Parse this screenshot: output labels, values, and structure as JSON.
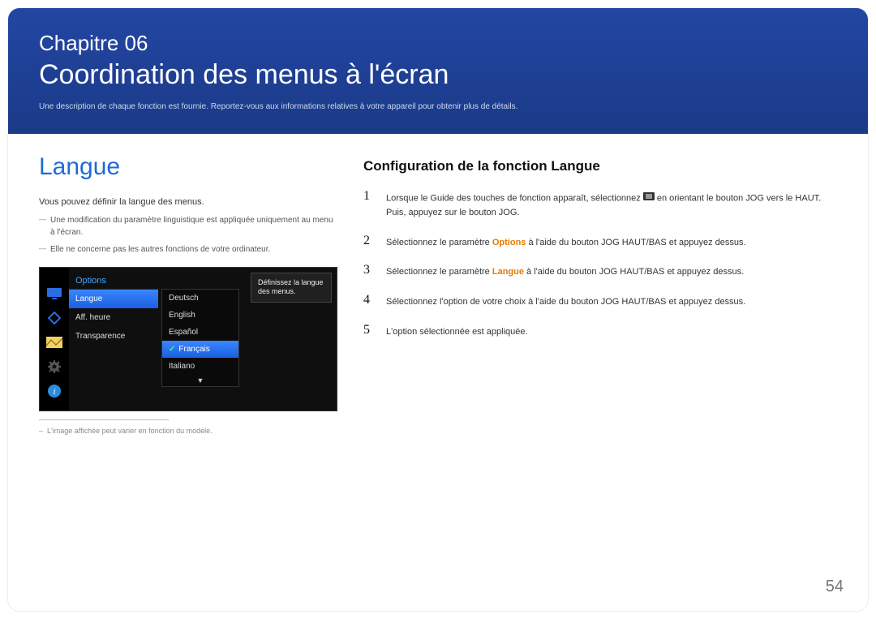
{
  "header": {
    "chapter": "Chapitre 06",
    "title": "Coordination des menus à l'écran",
    "desc": "Une description de chaque fonction est fournie. Reportez-vous aux informations relatives à votre appareil pour obtenir plus de détails."
  },
  "left": {
    "title": "Langue",
    "intro": "Vous pouvez définir la langue des menus.",
    "note1": "Une modification du paramètre linguistique est appliquée uniquement au menu à l'écran.",
    "note2": "Elle ne concerne pas les autres fonctions de votre ordinateur.",
    "footnote": "L'image affichée peut varier en fonction du modèle."
  },
  "osd": {
    "header": "Options",
    "items": [
      "Langue",
      "Aff. heure",
      "Transparence"
    ],
    "sub": [
      "Deutsch",
      "English",
      "Español",
      "Français",
      "Italiano"
    ],
    "sub_selected_index": 3,
    "tooltip": "Définissez la langue des menus."
  },
  "right": {
    "title": "Configuration de la fonction Langue",
    "steps": [
      {
        "num": "1",
        "pre": "Lorsque le Guide des touches de fonction apparaît, sélectionnez ",
        "post": " en orientant le bouton JOG vers le HAUT. Puis, appuyez sur le bouton JOG."
      },
      {
        "num": "2",
        "pre": "Sélectionnez le paramètre ",
        "option": "Options",
        "post": " à l'aide du bouton JOG HAUT/BAS et appuyez dessus."
      },
      {
        "num": "3",
        "pre": "Sélectionnez le paramètre ",
        "option": "Langue",
        "post": " à l'aide du bouton JOG HAUT/BAS et appuyez dessus."
      },
      {
        "num": "4",
        "text": "Sélectionnez l'option de votre choix à l'aide du bouton JOG HAUT/BAS et appuyez dessus."
      },
      {
        "num": "5",
        "text": "L'option sélectionnée est appliquée."
      }
    ]
  },
  "page_number": "54"
}
